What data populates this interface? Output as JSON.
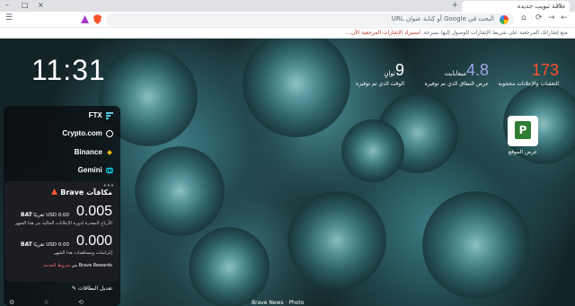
{
  "tab": {
    "title": "علامة تبويب جديدة",
    "close": "×",
    "new": "+"
  },
  "window": {
    "minimize": "–",
    "maximize": "□",
    "close": "×"
  },
  "toolbar": {
    "omnibox_placeholder": "البحث في Google أو كتابة عنوان URL",
    "back": "←",
    "forward": "→",
    "reload": "⟳",
    "home": "⌂"
  },
  "bookmarks": {
    "hint": "ضع إشاراتك المرجعية على شريط الإشارات للوصول إليها بسرعة.",
    "import_link": "استيراد الإشارات المرجعية الآن..."
  },
  "clock": "11:31",
  "stats": [
    {
      "value": "173",
      "unit": "",
      "label": "التعقبات والإعلانات محجوبة",
      "color": "#fb542b"
    },
    {
      "value": "4.8",
      "unit": "ميغابايت",
      "label": "عرض النطاق الذي تم توفيره",
      "color": "#a0a5eb"
    },
    {
      "value": "9",
      "unit": "ثوانٍ",
      "label": "الوقت الذي تم توفيره",
      "color": "#ffffff"
    }
  ],
  "top_site": {
    "initial": "P",
    "label": "عرض الموقع"
  },
  "exchanges": [
    "FTX",
    "Crypto.com",
    "Binance",
    "Gemini"
  ],
  "rewards": {
    "title": "مكافآت Brave",
    "menu": "•••",
    "earnings": {
      "amount": "0.005",
      "currency": "BAT",
      "usd": "0.00 USD تقريبًا",
      "desc": "الأرباح المقدرة لدورة الإعلانات الحالية من هذا الشهر"
    },
    "grants": {
      "amount": "0.000",
      "currency": "BAT",
      "usd": "0.00 USD تقريبًا",
      "desc": "إكراميات ومساهمات هذا الشهر"
    },
    "footer_prefix": "شروط الخدمة",
    "footer_suffix": "Brave Rewards من",
    "claim": "تعديل البطاقات"
  },
  "photo_credit": "Brave News · Photo"
}
